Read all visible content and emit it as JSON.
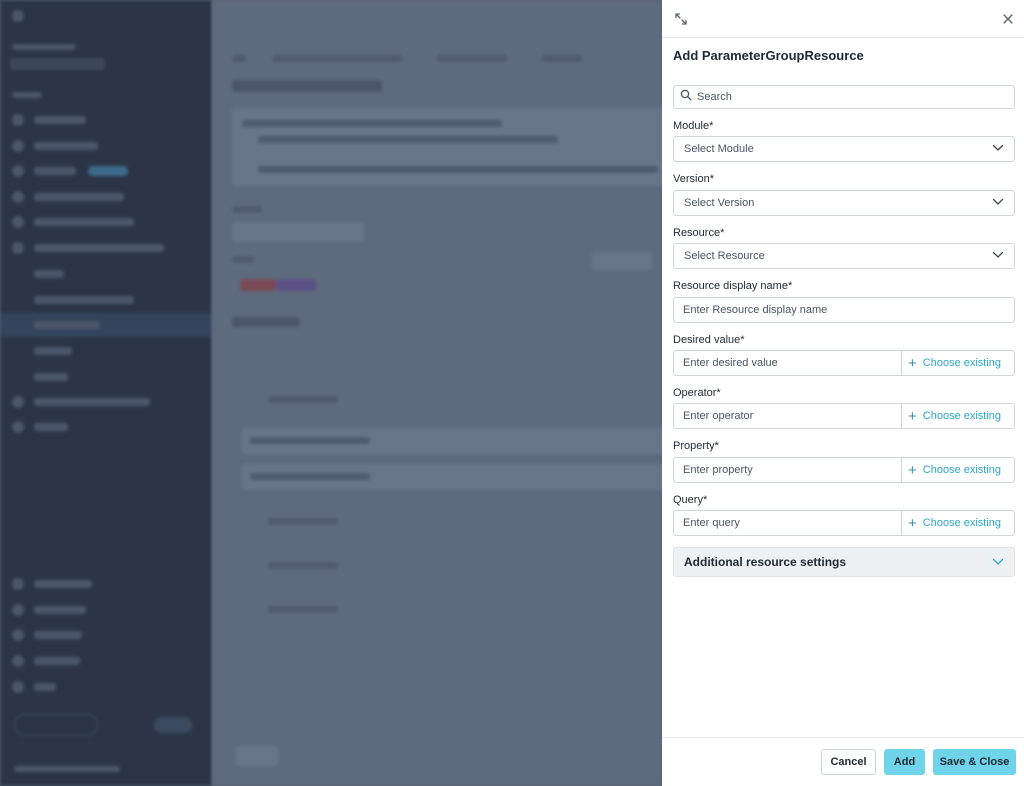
{
  "panel": {
    "title": "Add ParameterGroupResource",
    "search_placeholder": "Search",
    "fields": {
      "module": {
        "label": "Module*",
        "value": "Select Module"
      },
      "version": {
        "label": "Version*",
        "value": "Select Version"
      },
      "resource": {
        "label": "Resource*",
        "value": "Select Resource"
      },
      "display_name": {
        "label": "Resource display name*",
        "placeholder": "Enter Resource display name"
      },
      "desired_value": {
        "label": "Desired value*",
        "placeholder": "Enter desired value",
        "action": "Choose existing"
      },
      "operator": {
        "label": "Operator*",
        "placeholder": "Enter operator",
        "action": "Choose existing"
      },
      "property": {
        "label": "Property*",
        "placeholder": "Enter property",
        "action": "Choose existing"
      },
      "query": {
        "label": "Query*",
        "placeholder": "Enter query",
        "action": "Choose existing"
      }
    },
    "accordion": {
      "label": "Additional resource settings"
    },
    "footer": {
      "cancel": "Cancel",
      "add": "Add",
      "save_close": "Save & Close"
    }
  },
  "icons": {
    "expand": "expand-icon",
    "close": "close-icon",
    "search": "search-icon",
    "chevron": "chevron-down-icon",
    "plus": "plus-icon"
  },
  "colors": {
    "accent": "#6fd4ea",
    "link": "#2aa7c9",
    "overlay": "#596578"
  }
}
